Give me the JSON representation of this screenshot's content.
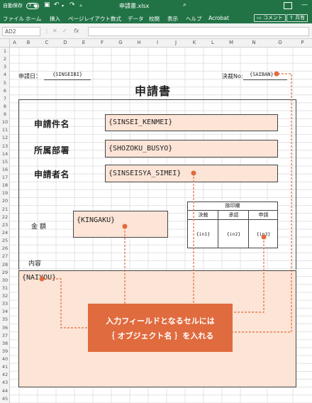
{
  "titlebar": {
    "autosave_label": "自動保存",
    "autosave_state": "オフ",
    "doc_title": "申請書.xlsx",
    "search_icon": "search-icon",
    "colors": {
      "brand": "#217346"
    }
  },
  "ribbon": {
    "tabs": [
      "ファイル",
      "ホーム",
      "挿入",
      "ページレイアウト",
      "数式",
      "データ",
      "校閲",
      "表示",
      "ヘルプ",
      "Acrobat"
    ],
    "comments_label": "コメント",
    "share_label": "共有"
  },
  "formula_bar": {
    "name_box": "AD2",
    "fx_label": "fx",
    "value": ""
  },
  "columns": [
    "A",
    "B",
    "C",
    "D",
    "E",
    "F",
    "G",
    "H",
    "I",
    "J",
    "K",
    "L",
    "M",
    "N",
    "O",
    "P"
  ],
  "rows": [
    "1",
    "2",
    "3",
    "4",
    "5",
    "6",
    "7",
    "8",
    "9",
    "10",
    "11",
    "12",
    "13",
    "14",
    "15",
    "16",
    "17",
    "18",
    "19",
    "20",
    "21",
    "22",
    "23",
    "24",
    "25",
    "26",
    "27",
    "28",
    "29",
    "30",
    "31",
    "32",
    "33",
    "34",
    "35",
    "36",
    "37",
    "38",
    "39",
    "40",
    "41",
    "42",
    "43",
    "44",
    "45"
  ],
  "sheet": {
    "date_label": "申請日：",
    "date_value": "{SINSEIBI}",
    "approval_no_label": "決裁No:",
    "approval_no_value": "{SAIBAN}",
    "title": "申請書",
    "fields": {
      "subject_label": "申請件名",
      "subject_value": "{SINSEI_KENMEI}",
      "dept_label": "所属部署",
      "dept_value": "{SHOZOKU_BUSYO}",
      "applicant_label": "申請者名",
      "applicant_value": "{SINSEISYA_SIMEI}",
      "amount_label": "金 額",
      "amount_value": "{KINGAKU}",
      "content_label": "内容",
      "content_value": "{NAIYOU}"
    },
    "stamp_table": {
      "header": "捺印欄",
      "columns": [
        "決裁",
        "承認",
        "申請"
      ],
      "cells": [
        "{in1}",
        "{in2}",
        "{in3}"
      ]
    }
  },
  "callout": {
    "line1": "入力フィールドとなるセルには",
    "line2": "｛ オブジェクト名 ｝を入れる",
    "color": "#e06b3e"
  }
}
